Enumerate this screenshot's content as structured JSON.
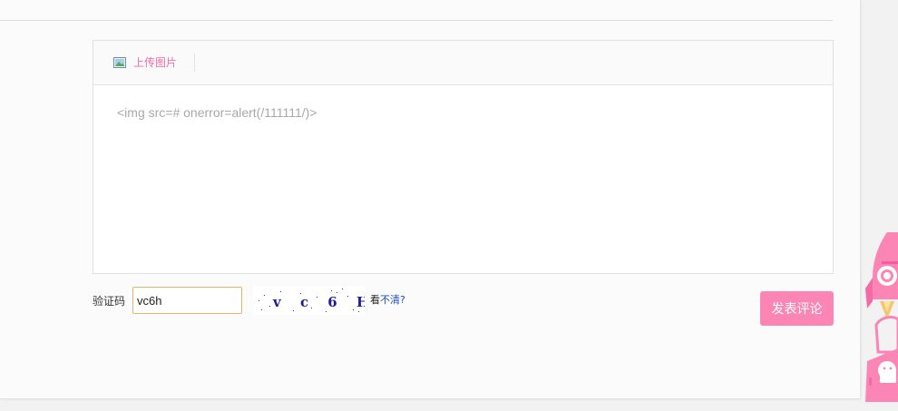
{
  "editor": {
    "upload_label": "上传图片",
    "content": "<img src=# onerror=alert(/111111/)>"
  },
  "captcha": {
    "label": "验证码",
    "value": "vc6h",
    "image_text": "v c 6 H",
    "refresh_prefix": "看",
    "refresh_label": "不清?"
  },
  "submit_label": "发表评论",
  "colors": {
    "accent_pink": "#fb86b6",
    "upload_text": "#f06eaa",
    "captcha_border": "#e3b56b",
    "link_blue": "#1a4fbf"
  },
  "icons": {
    "upload": "image-icon",
    "mascot": "rocket-android-mascot-icon"
  }
}
